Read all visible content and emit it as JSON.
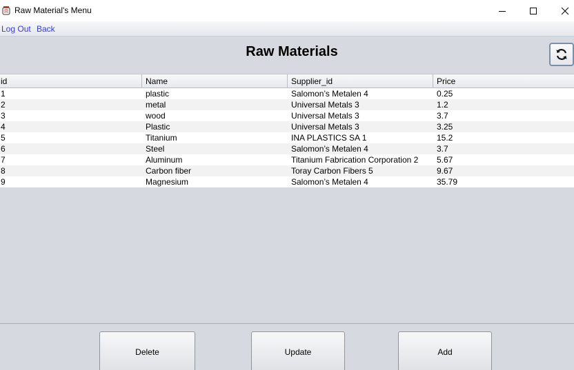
{
  "window": {
    "title": "Raw Material's Menu",
    "icon": "jar-app-icon",
    "controls": [
      "minimize-icon",
      "maximize-icon",
      "close-icon"
    ]
  },
  "menubar": {
    "logout_label": "Log Out",
    "back_label": "Back",
    "link_color": "#3a3ad0"
  },
  "main": {
    "heading": "Raw Materials",
    "refresh_icon": "refresh-icon"
  },
  "table": {
    "columns": [
      "id",
      "Name",
      "Supplier_id",
      "Price"
    ],
    "rows": [
      [
        "1",
        "plastic",
        "Salomon’s Metalen 4",
        "0.25"
      ],
      [
        "2",
        "metal",
        "Universal Metals 3",
        "1.2"
      ],
      [
        "3",
        "wood",
        "Universal Metals 3",
        "3.7"
      ],
      [
        "4",
        "Plastic",
        "Universal Metals 3",
        "3.25"
      ],
      [
        "5",
        "Titanium",
        "INA PLASTICS SA 1",
        "15.2"
      ],
      [
        "6",
        "Steel",
        "Salomon’s Metalen 4",
        "3.7"
      ],
      [
        "7",
        "Aluminum",
        "Titanium Fabrication Corporation 2",
        "5.67"
      ],
      [
        "8",
        "Carbon fiber",
        "Toray Carbon Fibers 5",
        "9.67"
      ],
      [
        "9",
        "Magnesium",
        "Salomon’s Metalen 4",
        "35.79"
      ]
    ]
  },
  "actions": {
    "delete_label": "Delete",
    "update_label": "Update",
    "add_label": "Add"
  }
}
